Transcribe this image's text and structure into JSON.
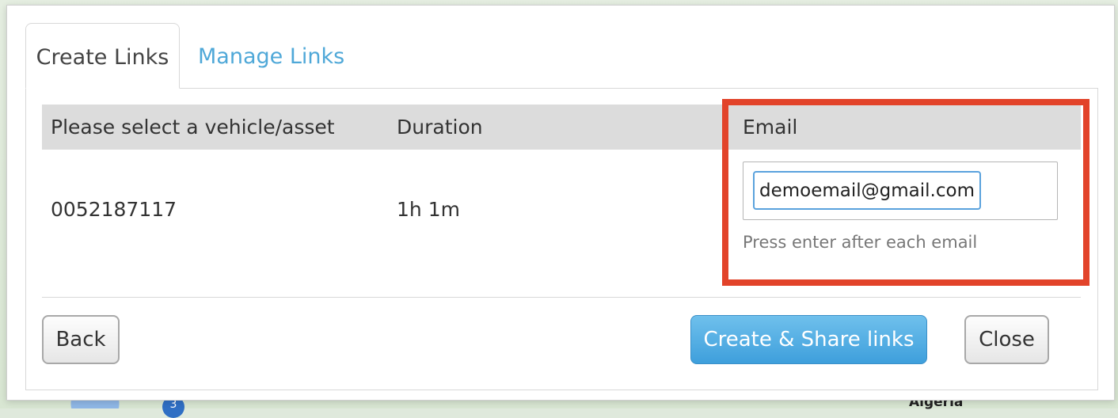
{
  "map": {
    "label": "Algeria",
    "cluster_badge": "3"
  },
  "tabs": [
    {
      "label": "Create Links",
      "active": true
    },
    {
      "label": "Manage Links",
      "active": false
    }
  ],
  "table": {
    "headers": [
      "Please select a vehicle/asset",
      "Duration",
      "Email"
    ],
    "row": {
      "vehicle": "0052187117",
      "duration": "1h 1m"
    }
  },
  "email": {
    "value": "demoemail@gmail.com",
    "hint": "Press enter after each email"
  },
  "buttons": {
    "back": "Back",
    "create_share": "Create & Share links",
    "close": "Close"
  },
  "colors": {
    "highlight": "#e2432a",
    "accent": "#4fa8d8",
    "primary_button": "#3e9fdc"
  }
}
